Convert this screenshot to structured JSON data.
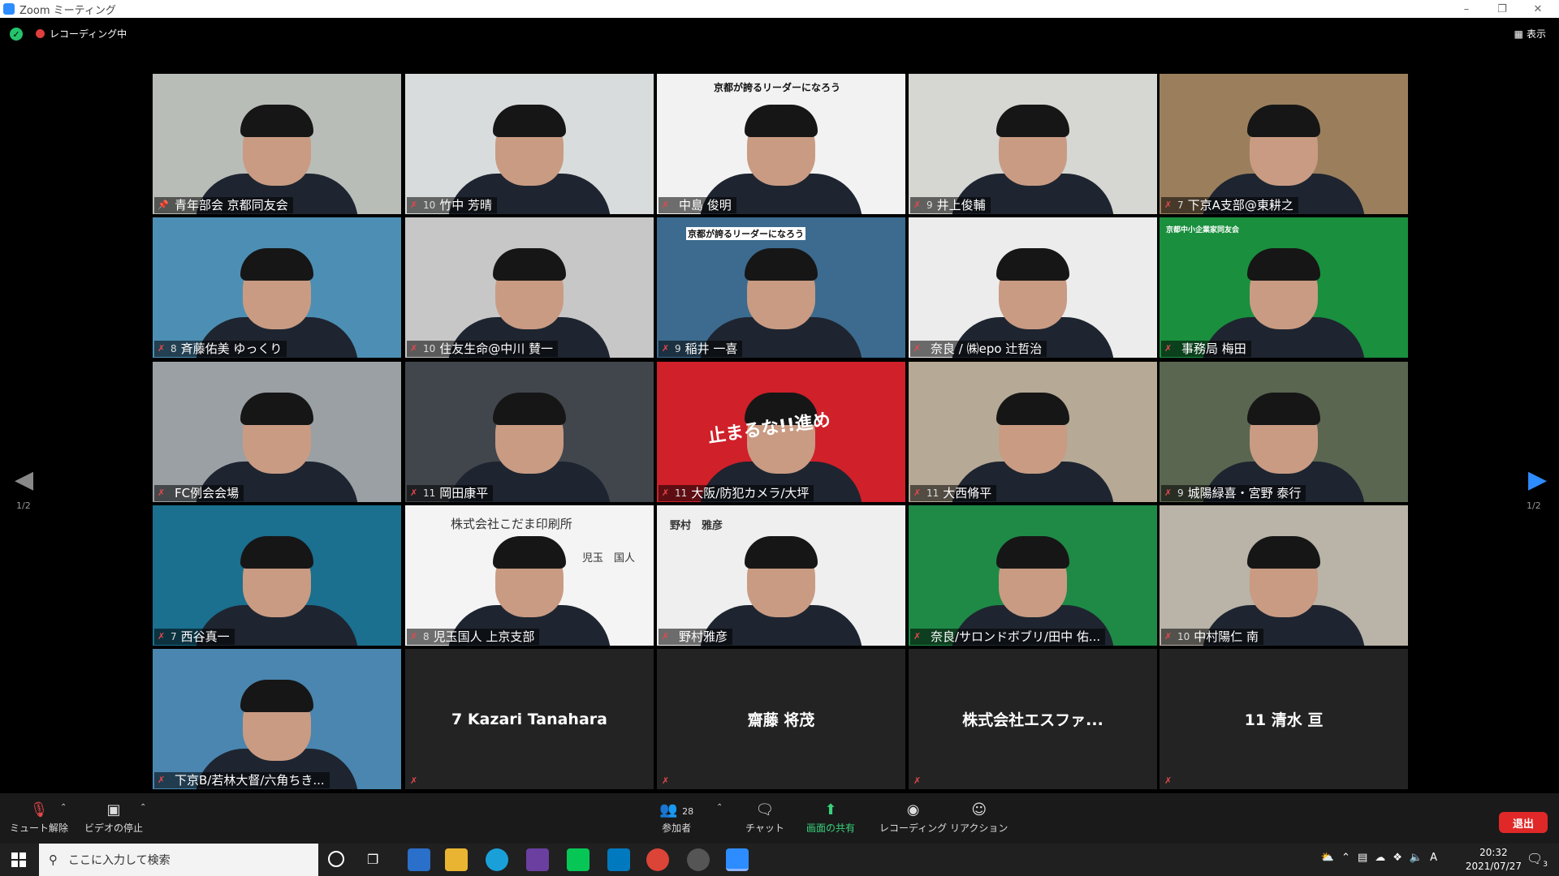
{
  "window": {
    "title": "Zoom ミーティング"
  },
  "status": {
    "recording_label": "レコーディング中",
    "view_label": "表示"
  },
  "nav": {
    "page": "1/2"
  },
  "tiles": [
    {
      "kind": "video",
      "name": "青年部会 京都同友会",
      "num": "",
      "icon": "pin",
      "active": true,
      "bg": "#b9bdb8"
    },
    {
      "kind": "video",
      "name": "竹中 芳晴",
      "num": "10",
      "icon": "mic",
      "bg": "#d9dcdc"
    },
    {
      "kind": "video",
      "name": "中島 俊明",
      "num": "",
      "icon": "mic",
      "bg": "#f2f2f2"
    },
    {
      "kind": "video",
      "name": "井上俊輔",
      "num": "9",
      "icon": "mic",
      "bg": "#d6d6d2"
    },
    {
      "kind": "video",
      "name": "下京A支部@東耕之",
      "num": "7",
      "icon": "mic",
      "bg": "#9b7f5c"
    },
    {
      "kind": "video",
      "name": "斉藤佑美 ゆっくり",
      "num": "8",
      "icon": "mic",
      "bg": "#4d8fb4"
    },
    {
      "kind": "video",
      "name": "住友生命@中川 賛一",
      "num": "10",
      "icon": "mic",
      "bg": "#c7c7c7"
    },
    {
      "kind": "video",
      "name": "稲井 一喜",
      "num": "9",
      "icon": "mic",
      "bg": "#3c6b8f"
    },
    {
      "kind": "video",
      "name": "奈良 / ㈱epo 辻哲治",
      "num": "",
      "icon": "mic",
      "bg": "#ececec"
    },
    {
      "kind": "video",
      "name": "事務局 梅田",
      "num": "",
      "icon": "mic",
      "bg": "#1a8f3e"
    },
    {
      "kind": "video",
      "name": "FC例会会場",
      "num": "",
      "icon": "mic",
      "bg": "#9aa0a4"
    },
    {
      "kind": "video",
      "name": "岡田康平",
      "num": "11",
      "icon": "mic",
      "bg": "#41464c"
    },
    {
      "kind": "video",
      "name": "大阪/防犯カメラ/大坪",
      "num": "11",
      "icon": "mic",
      "bg": "#d0202a"
    },
    {
      "kind": "video",
      "name": "大西脩平",
      "num": "11",
      "icon": "mic",
      "bg": "#b6a996"
    },
    {
      "kind": "video",
      "name": "城陽緑喜・宮野 泰行",
      "num": "9",
      "icon": "mic",
      "bg": "#5a6650"
    },
    {
      "kind": "video",
      "name": "西谷真一",
      "num": "7",
      "icon": "mic",
      "bg": "#1b6f8f"
    },
    {
      "kind": "video",
      "name": "児玉国人 上京支部",
      "num": "8",
      "icon": "mic",
      "bg": "#f4f4f4"
    },
    {
      "kind": "video",
      "name": "野村雅彦",
      "num": "",
      "icon": "mic",
      "bg": "#efefef"
    },
    {
      "kind": "video",
      "name": "奈良/サロンドボブリ/田中 佑...",
      "num": "",
      "icon": "mic",
      "bg": "#1e8a46"
    },
    {
      "kind": "video",
      "name": "中村陽仁 南",
      "num": "10",
      "icon": "mic",
      "bg": "#b9b3a8"
    },
    {
      "kind": "video",
      "name": "下京B/若林大督/六角ちき...",
      "num": "",
      "icon": "mic",
      "bg": "#4a86b0"
    },
    {
      "kind": "blank",
      "name": "7  Kazari Tanahara"
    },
    {
      "kind": "blank",
      "name": "齋藤 将茂"
    },
    {
      "kind": "blank",
      "name": "株式会社エスファ..."
    },
    {
      "kind": "blank",
      "name": "11 清水  亘"
    }
  ],
  "slides": {
    "leader_title": "京都が誇るリーダーになろう",
    "company_sign": "株式会社こだま印刷所",
    "company_person": "児玉　国人",
    "card_name": "野村　雅彦",
    "banner_text": "止まるな!!進め",
    "office_label": "京都中小企業家同友会"
  },
  "toolbar": {
    "mute": "ミュート解除",
    "video": "ビデオの停止",
    "participants": "参加者",
    "participants_count": "28",
    "chat": "チャット",
    "share": "画面の共有",
    "record": "レコーディング",
    "reaction": "リアクション",
    "leave": "退出"
  },
  "taskbar": {
    "search_placeholder": "ここに入力して検索",
    "time": "20:32",
    "date": "2021/07/27",
    "ime": "A",
    "notif_count": "3"
  },
  "colors": {
    "active_border": "#d7e35a",
    "leave_red": "#e02828",
    "share_green": "#38d27b",
    "mic_muted": "#e5484d"
  }
}
